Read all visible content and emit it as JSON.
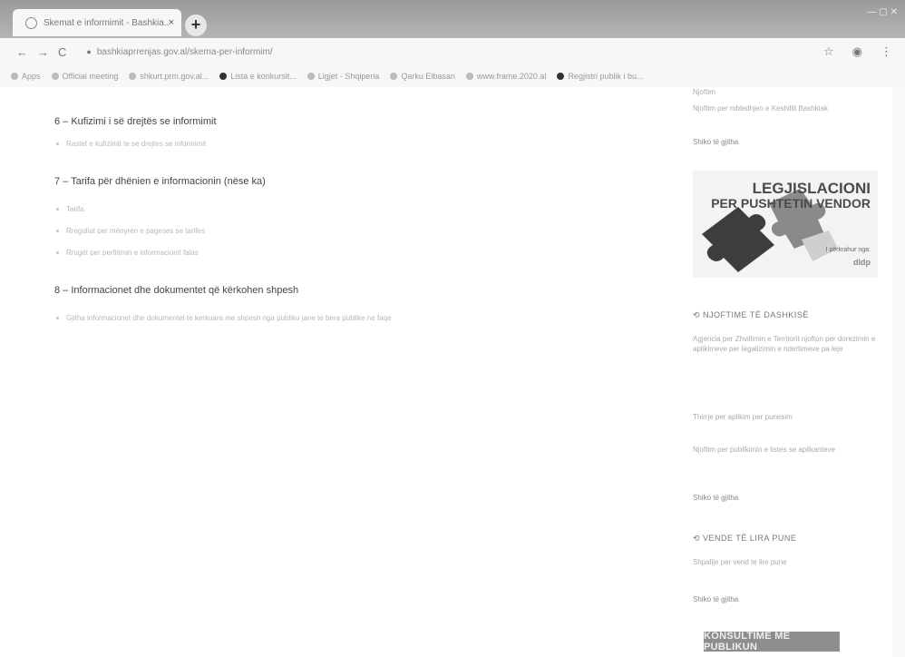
{
  "browser": {
    "tab_title": "Skemat e informimit - Bashkia...",
    "tab_close": "×",
    "new_tab": "+",
    "url": "bashkiaprrenjas.gov.al/skema-per-informim/",
    "bookmarks": [
      {
        "label": "Apps"
      },
      {
        "label": "Official meeting"
      },
      {
        "label": "shkurt.prm.gov.al..."
      },
      {
        "label": "Lista e konkursit..."
      },
      {
        "label": "Ligjet - Shqiperia"
      },
      {
        "label": "Qarku Elbasan"
      },
      {
        "label": "www.frame.2020.al"
      },
      {
        "label": "Regjistri publik i bu..."
      }
    ]
  },
  "main": {
    "sections": [
      {
        "title": "6 – Kufizimi i së drejtës se informimit",
        "items": [
          "Rastet e kufizimit te se drejtes se informimit"
        ]
      },
      {
        "title": "7 – Tarifa për dhënien e informacionin (nëse ka)",
        "items": [
          "Tarifa",
          "Rregullat per mënyren e pageses se tarifes",
          "Rrugët per perfitimin e informacionit falas"
        ]
      },
      {
        "title": "8 – Informacionet dhe dokumentet që kërkohen shpesh",
        "items": [
          "Gjitha informacionet dhe dokumentet te kerkuara me shpesh nga publiku jane te bera publike ne faqe"
        ]
      }
    ]
  },
  "sidebar": {
    "top_text_1": "Njoftim",
    "top_text_2": "Njoftim per mbledhjen e Keshillit Bashkiak",
    "see_all_1": "Shiko të gjitha",
    "banner": {
      "line1": "LEGJISLACIONI",
      "line2": "PER PUSHTETIN VENDOR",
      "supported": "I përkrahur nga:",
      "logo": "dldp"
    },
    "news_heading": "NJOFTIME TË DASHKISË",
    "news_items": [
      "Agjencia per Zhvillimin e Territorit njofton per dorezimin e aplikimeve per legalizimin e ndertimeve pa leje",
      "Thirrje per aplikim per punesim",
      "Njoftim per publikimin e listes se aplikanteve"
    ],
    "see_all_2": "Shiko të gjitha",
    "jobs_heading": "VENDE TË LIRA PUNE",
    "jobs_text": "Shpallje per vend te lire pune",
    "see_all_3": "Shiko të gjitha",
    "consult_button": "KONSULTIME ME PUBLIKUN"
  }
}
